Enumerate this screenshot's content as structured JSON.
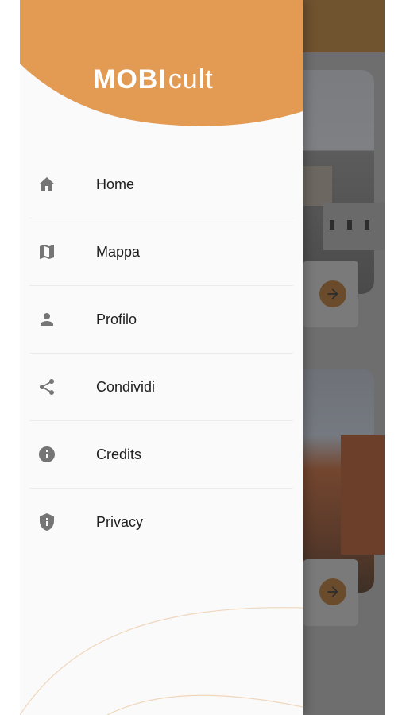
{
  "app": {
    "logo_text_strong": "MOBI",
    "logo_text_light": "cult"
  },
  "colors": {
    "accent": "#E39B53",
    "icon_gray": "#757575",
    "drawer_bg": "#FAFAFA",
    "scrim_topbar": "#70532F"
  },
  "menu": {
    "items": [
      {
        "label": "Home",
        "icon": "home-icon"
      },
      {
        "label": "Mappa",
        "icon": "map-icon"
      },
      {
        "label": "Profilo",
        "icon": "person-icon"
      },
      {
        "label": "Condividi",
        "icon": "share-icon"
      },
      {
        "label": "Credits",
        "icon": "info-icon"
      },
      {
        "label": "Privacy",
        "icon": "shield-icon"
      }
    ]
  }
}
